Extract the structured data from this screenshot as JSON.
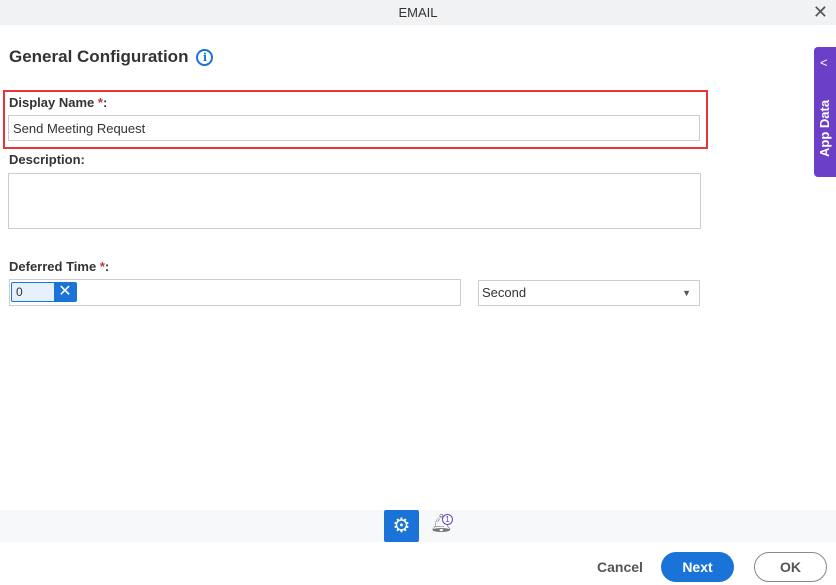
{
  "dialog": {
    "title": "EMAIL",
    "close_icon": "close-icon"
  },
  "section": {
    "title": "General Configuration",
    "info_icon": "info-icon"
  },
  "fields": {
    "display_name": {
      "label": "Display Name",
      "required": "*",
      "suffix": ":",
      "value": "Send Meeting Request"
    },
    "description": {
      "label": "Description:",
      "value": ""
    },
    "deferred_time": {
      "label": "Deferred Time",
      "required": "*",
      "suffix": ":",
      "value": "0",
      "unit": "Second"
    }
  },
  "side_panel": {
    "label": "App Data"
  },
  "toolbar": {
    "notification_count": "1"
  },
  "buttons": {
    "cancel": "Cancel",
    "next": "Next",
    "ok": "OK"
  },
  "colors": {
    "accent": "#1a73d6",
    "highlight": "#e9353a",
    "app_data": "#6c3fc9"
  }
}
